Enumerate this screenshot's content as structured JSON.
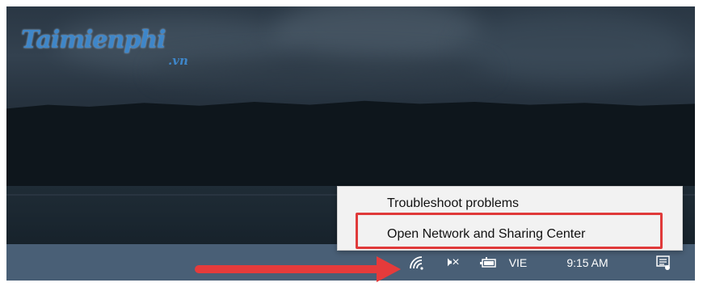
{
  "logo": {
    "text": "Taimienphi",
    "sub": ".vn"
  },
  "context_menu": {
    "items": [
      {
        "label": "Troubleshoot problems"
      },
      {
        "label": "Open Network and Sharing Center"
      }
    ]
  },
  "taskbar": {
    "icons": [
      "wifi-icon",
      "volume-muted-icon",
      "battery-icon",
      "notification-icon"
    ],
    "volume_glyph": "🕨×",
    "language": "VIE",
    "time": "9:15 AM"
  },
  "colors": {
    "taskbar": "#495f76",
    "highlight": "#e03a3a",
    "arrow": "#e53b3b",
    "menu_bg": "#f2f2f2"
  }
}
